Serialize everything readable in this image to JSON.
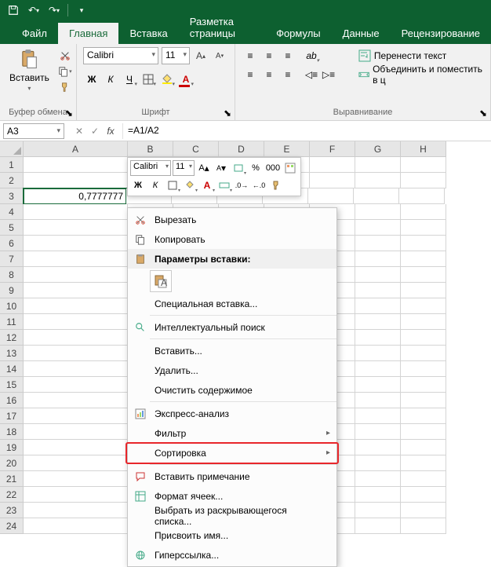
{
  "titlebar": {
    "save": "save",
    "undo": "undo",
    "redo": "redo"
  },
  "tabs": {
    "file": "Файл",
    "home": "Главная",
    "insert": "Вставка",
    "layout": "Разметка страницы",
    "formulas": "Формулы",
    "data": "Данные",
    "review": "Рецензирование"
  },
  "ribbon": {
    "clipboard": {
      "title": "Буфер обмена",
      "paste": "Вставить"
    },
    "font": {
      "title": "Шрифт",
      "name": "Calibri",
      "size": "11",
      "bold": "Ж",
      "italic": "К",
      "underline": "Ч"
    },
    "alignment": {
      "title": "Выравнивание",
      "wrap": "Перенести текст",
      "merge": "Объединить и поместить в ц"
    }
  },
  "formula_bar": {
    "cell_ref": "A3",
    "formula": "=A1/A2"
  },
  "sheet": {
    "columns": [
      "A",
      "B",
      "C",
      "D",
      "E",
      "F",
      "G",
      "H"
    ],
    "row_count": 24,
    "cells": {
      "A3": "0,7777777"
    }
  },
  "mini_toolbar": {
    "font": "Calibri",
    "size": "11",
    "bold": "Ж",
    "italic": "К",
    "percent": "%",
    "thousands": "000"
  },
  "context_menu": {
    "cut": "Вырезать",
    "copy": "Копировать",
    "paste_options": "Параметры вставки:",
    "paste_special": "Специальная вставка...",
    "smart_lookup": "Интеллектуальный поиск",
    "insert": "Вставить...",
    "delete": "Удалить...",
    "clear": "Очистить содержимое",
    "quick_analysis": "Экспресс-анализ",
    "filter": "Фильтр",
    "sort": "Сортировка",
    "comment": "Вставить примечание",
    "format_cells": "Формат ячеек...",
    "dropdown_pick": "Выбрать из раскрывающегося списка...",
    "define_name": "Присвоить имя...",
    "hyperlink": "Гиперссылка..."
  }
}
